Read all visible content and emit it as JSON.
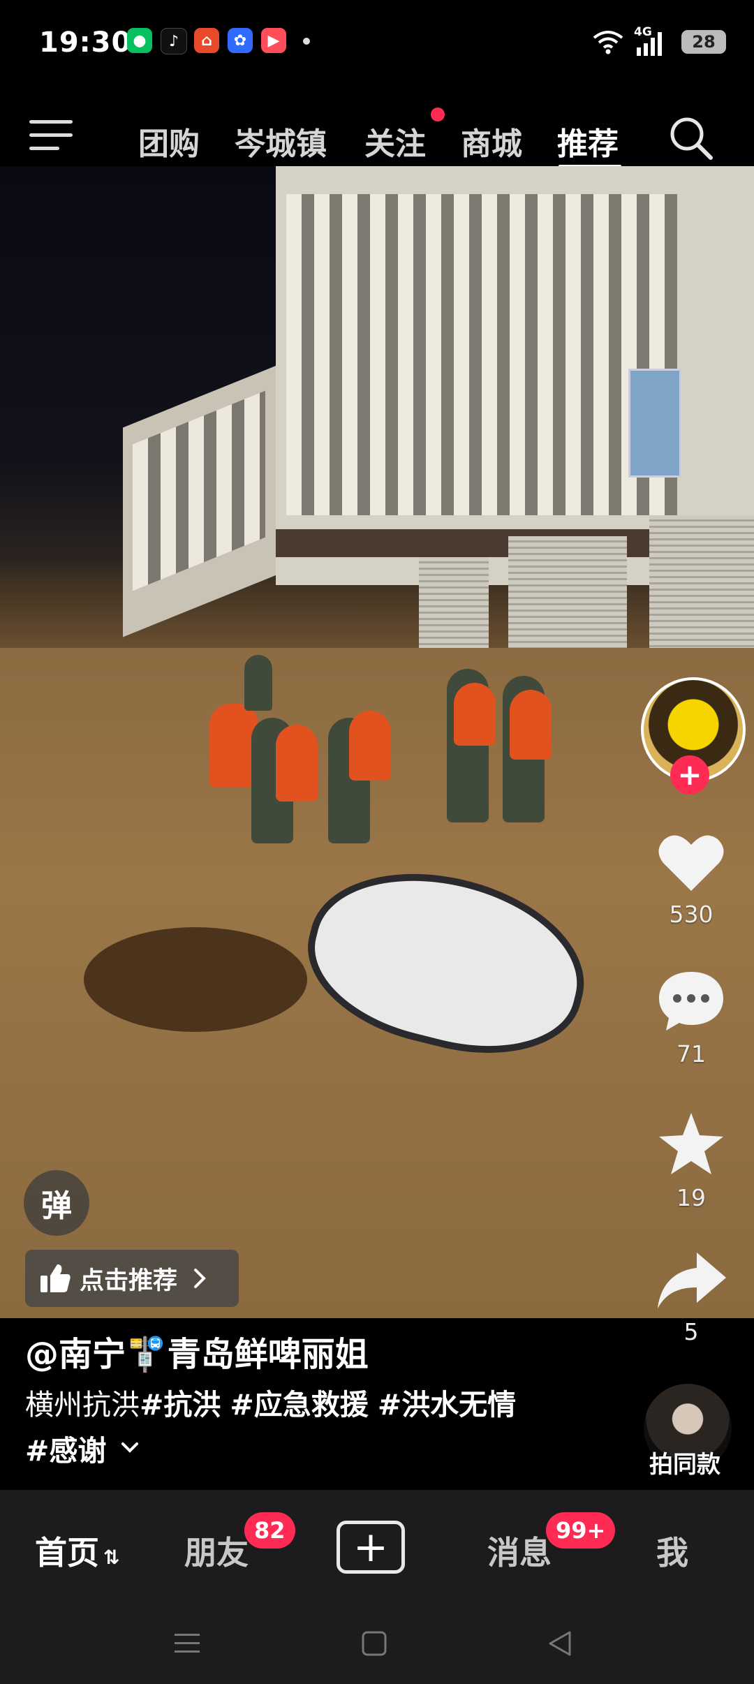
{
  "status": {
    "time": "19:30",
    "network": "4G",
    "battery": "28"
  },
  "topnav": {
    "tabs": [
      "团购",
      "岑城镇",
      "关注",
      "商城",
      "推荐"
    ],
    "active_tab": "推荐"
  },
  "video": {
    "author": "@南宁🚏青岛鲜啤丽姐",
    "desc_plain": "横州抗洪",
    "desc_tags": [
      "#抗洪",
      "#应急救援",
      "#洪水无情",
      "#感谢"
    ],
    "danmu_label": "弹",
    "recommend_label": "点击推荐",
    "same_style_label": "拍同款"
  },
  "actions": {
    "likes": "530",
    "comments": "71",
    "favorites": "19",
    "shares": "5"
  },
  "bottombar": {
    "home": "首页",
    "friends": "朋友",
    "friends_badge": "82",
    "messages": "消息",
    "messages_badge": "99+",
    "me": "我"
  },
  "colors": {
    "accent": "#fe2c55",
    "bar_bg": "#1c1c1e"
  }
}
